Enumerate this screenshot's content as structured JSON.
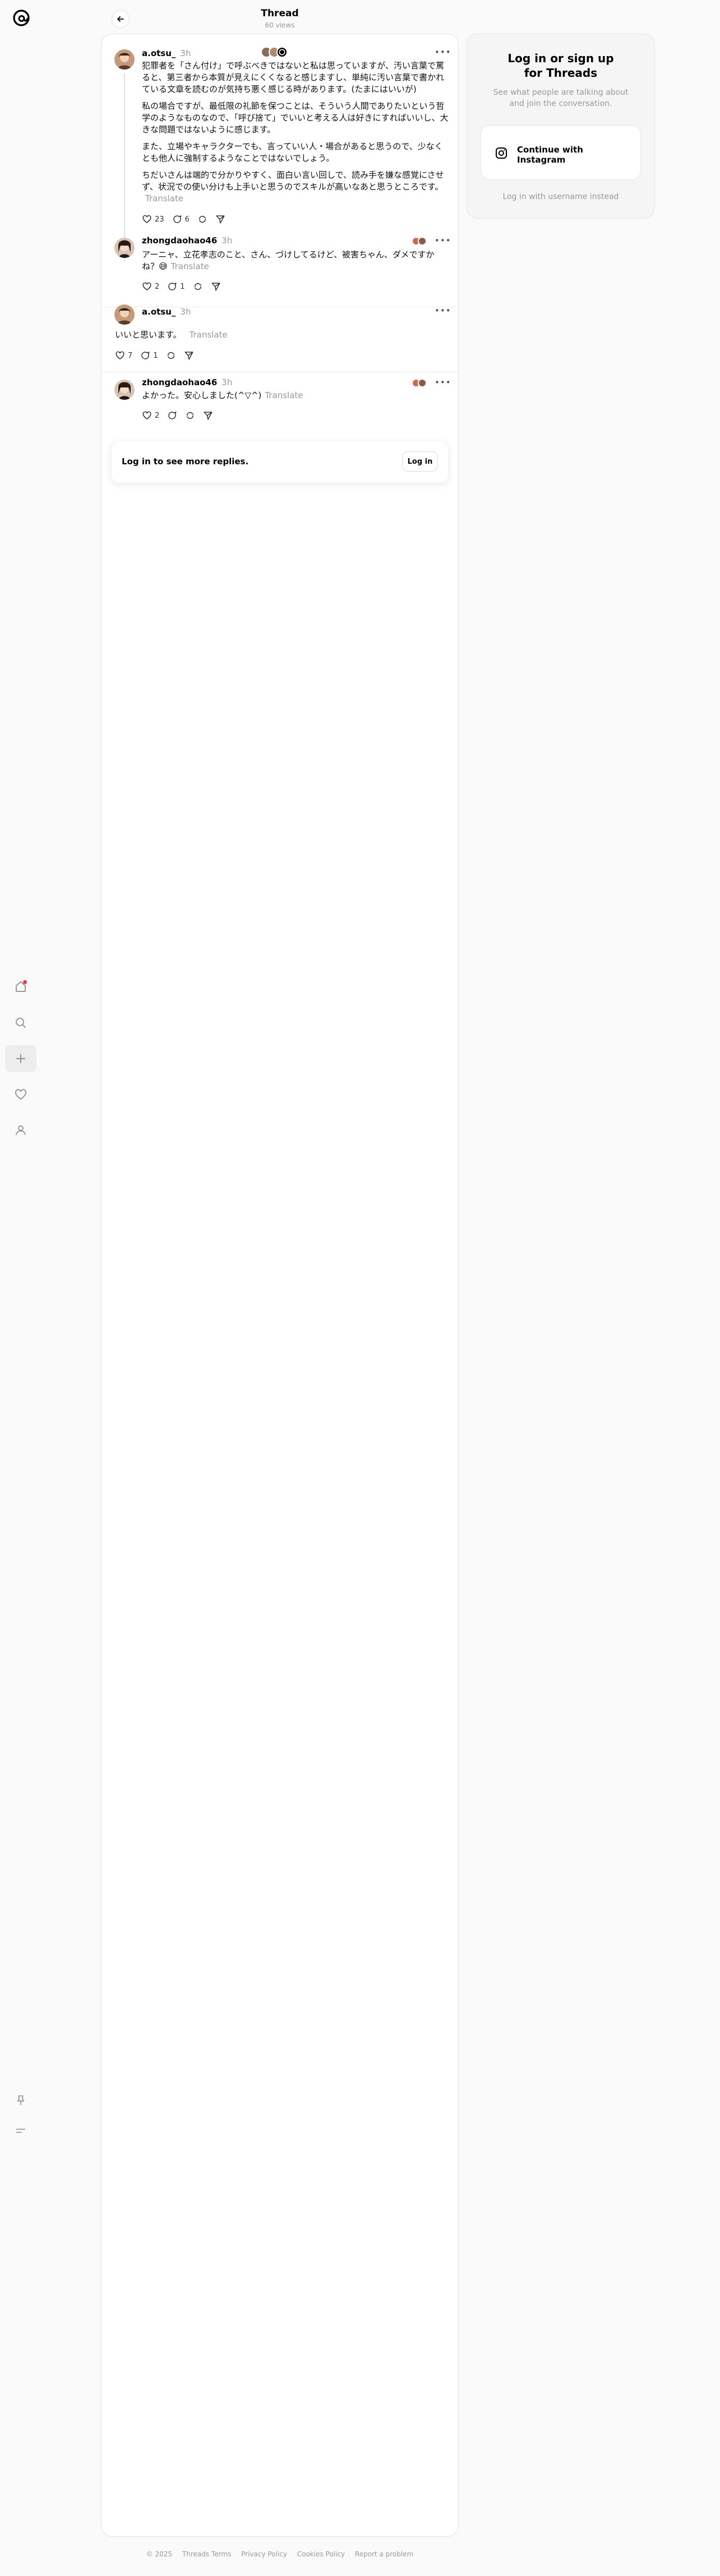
{
  "app": {
    "logo": "threads-logo"
  },
  "nav": {
    "items": [
      {
        "name": "home-icon"
      },
      {
        "name": "search-icon"
      },
      {
        "name": "create-icon"
      },
      {
        "name": "heart-icon"
      },
      {
        "name": "profile-icon"
      }
    ],
    "bottom": [
      {
        "name": "pin-icon"
      },
      {
        "name": "menu-icon"
      }
    ]
  },
  "header": {
    "title": "Thread",
    "views": "60 views"
  },
  "posts": [
    {
      "username": "a.otsu_",
      "time": "3h",
      "paragraphs": [
        "犯罪者を「さん付け」で呼ぶべきではないと私は思っていますが、汚い言葉で罵ると、第三者から本質が見えにくくなると感じますし、単純に汚い言葉で書かれている文章を読むのが気持ち悪く感じる時があります。(たまにはいいが)",
        "私の場合ですが、最低限の礼節を保つことは、そういう人間でありたいという哲学のようなものなので、「呼び捨て」でいいと考える人は好きにすればいいし、大きな問題ではないように感じます。",
        "また、立場やキャラクターでも、言っていい人・場合があると思うので、少なくとも他人に強制するようなことではないでしょう。",
        "ちだいさんは端的で分かりやすく、面白い言い回しで、読み手を嫌な感覚にさせず、状況での使い分けも上手いと思うのでスキルが高いなあと思うところです。"
      ],
      "translate": "Translate",
      "likes": "23",
      "replies": "6"
    },
    {
      "username": "zhongdaohao46",
      "time": "3h",
      "text": "アーニャ、立花孝志のこと、さん、づけしてるけど、被害ちゃん、ダメですかね？😅",
      "translate": "Translate",
      "likes": "2",
      "replies": "1"
    },
    {
      "username": "a.otsu_",
      "time": "3h",
      "text": "いいと思います。",
      "translate": "Translate",
      "likes": "7",
      "replies": "1"
    },
    {
      "username": "zhongdaohao46",
      "time": "3h",
      "text": "よかった。安心しました(^▽^)",
      "translate": "Translate",
      "likes": "2",
      "replies": ""
    }
  ],
  "login_prompt": {
    "text": "Log in to see more replies.",
    "button": "Log in"
  },
  "sidebar": {
    "title": "Log in or sign up for Threads",
    "subtitle": "See what people are talking about and join the conversation.",
    "instagram_button": "Continue with Instagram",
    "username_link": "Log in with username instead"
  },
  "footer": [
    "© 2025",
    "Threads Terms",
    "Privacy Policy",
    "Cookies Policy",
    "Report a problem"
  ],
  "colors": {
    "accent": "#000000",
    "notification": "#ff3040",
    "muted": "#999999"
  }
}
